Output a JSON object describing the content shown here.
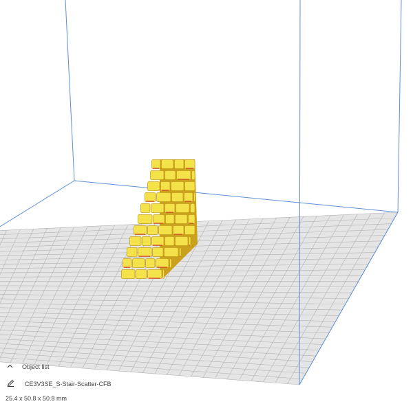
{
  "object_list": {
    "toggle_icon": "chevron-up-icon",
    "label": "Object list",
    "edit_icon": "pencil-icon",
    "object_name": "CE3V3SE_S-Stair-Scatter-CFB",
    "dimensions": "25.4 x 50.8 x 50.8 mm"
  },
  "colors": {
    "build_plate": "#e5e5e5",
    "grid_line": "#b3b3b3",
    "volume_edge": "#5b8fd6",
    "model_fill": "#f4e24a",
    "model_shadow": "#c9a11c",
    "model_overhang": "#d42a2a"
  }
}
